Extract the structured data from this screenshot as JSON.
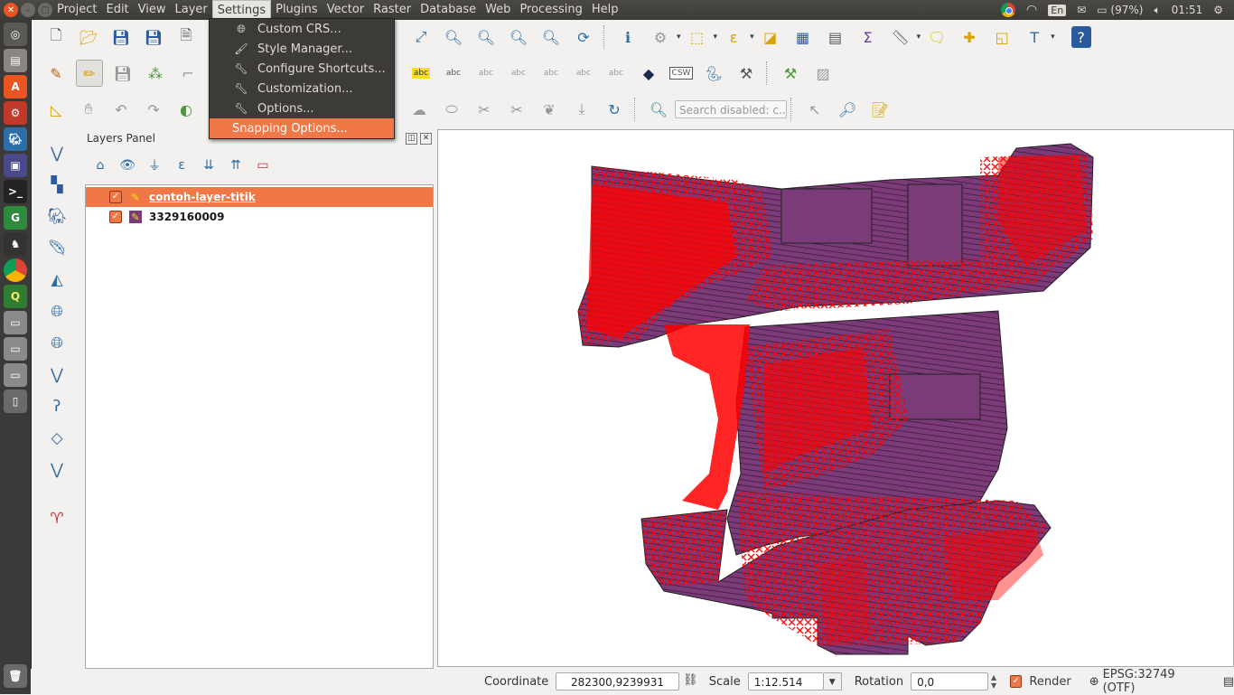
{
  "menubar": {
    "items": [
      "Project",
      "Edit",
      "View",
      "Layer",
      "Settings",
      "Plugins",
      "Vector",
      "Raster",
      "Database",
      "Web",
      "Processing",
      "Help"
    ],
    "active": "Settings"
  },
  "indicators": {
    "keyboard": "En",
    "battery": "(97%)",
    "clock": "01:51"
  },
  "settings_menu": {
    "items": [
      {
        "label": "Custom CRS...",
        "icon": "crs-icon"
      },
      {
        "label": "Style Manager...",
        "icon": "style-manager-icon"
      },
      {
        "label": "Configure Shortcuts...",
        "icon": "wrench-icon"
      },
      {
        "label": "Customization...",
        "icon": "wrench-icon"
      },
      {
        "label": "Options...",
        "icon": "wrench-icon"
      },
      {
        "label": "Snapping Options...",
        "icon": ""
      }
    ],
    "highlighted": "Snapping Options..."
  },
  "toolbar": {
    "search_placeholder": "Search disabled: c...",
    "label_abc": "abc",
    "label_csw": "CSW"
  },
  "layers_panel": {
    "title": "Layers Panel",
    "layers": [
      {
        "name": "contoh-layer-titik",
        "checked": true,
        "selected": true
      },
      {
        "name": "3329160009",
        "checked": true,
        "selected": false
      }
    ]
  },
  "statusbar": {
    "coordinate_label": "Coordinate",
    "coordinate_value": "282300,9239931",
    "scale_label": "Scale",
    "scale_value": "1:12.514",
    "rotation_label": "Rotation",
    "rotation_value": "0,0",
    "render_label": "Render",
    "crs_label": "EPSG:32749 (OTF)"
  },
  "colors": {
    "accent": "#f07746",
    "polygon_fill": "#7b3a78",
    "vertex_markers": "#ff0000"
  }
}
